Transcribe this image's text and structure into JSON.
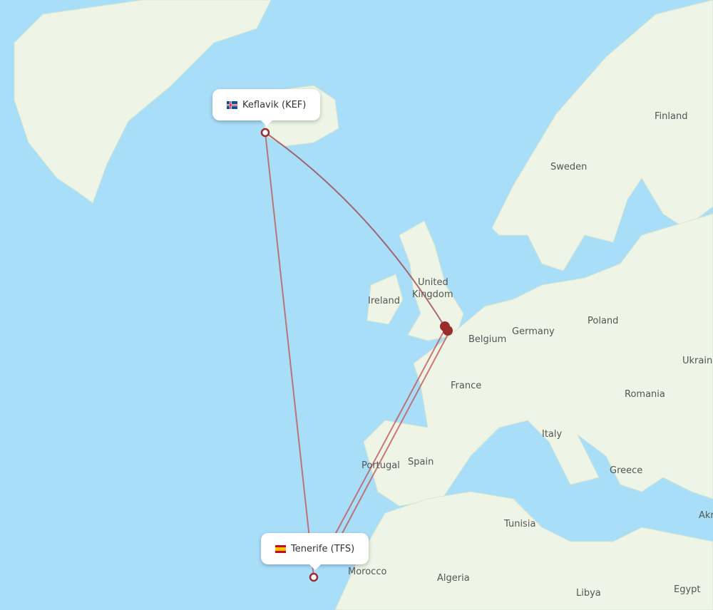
{
  "colors": {
    "ocean": "#a9def9",
    "land": "#eef5e6",
    "route": "#c0595b",
    "marker": "#9b2c2c"
  },
  "airports": [
    {
      "name": "Keflavik (KEF)",
      "flag": "iceland-flag-icon"
    },
    {
      "name": "Tenerife (TFS)",
      "flag": "spain-flag-icon"
    }
  ],
  "countries": [
    "Finland",
    "Sweden",
    "United",
    "Kingdom",
    "Ireland",
    "Poland",
    "Germany",
    "Belgium",
    "Ukraine",
    "France",
    "Romania",
    "Italy",
    "Spain",
    "Portugal",
    "Greece",
    "Tunisia",
    "Morocco",
    "Algeria",
    "Libya",
    "Egypt",
    "Akr"
  ]
}
